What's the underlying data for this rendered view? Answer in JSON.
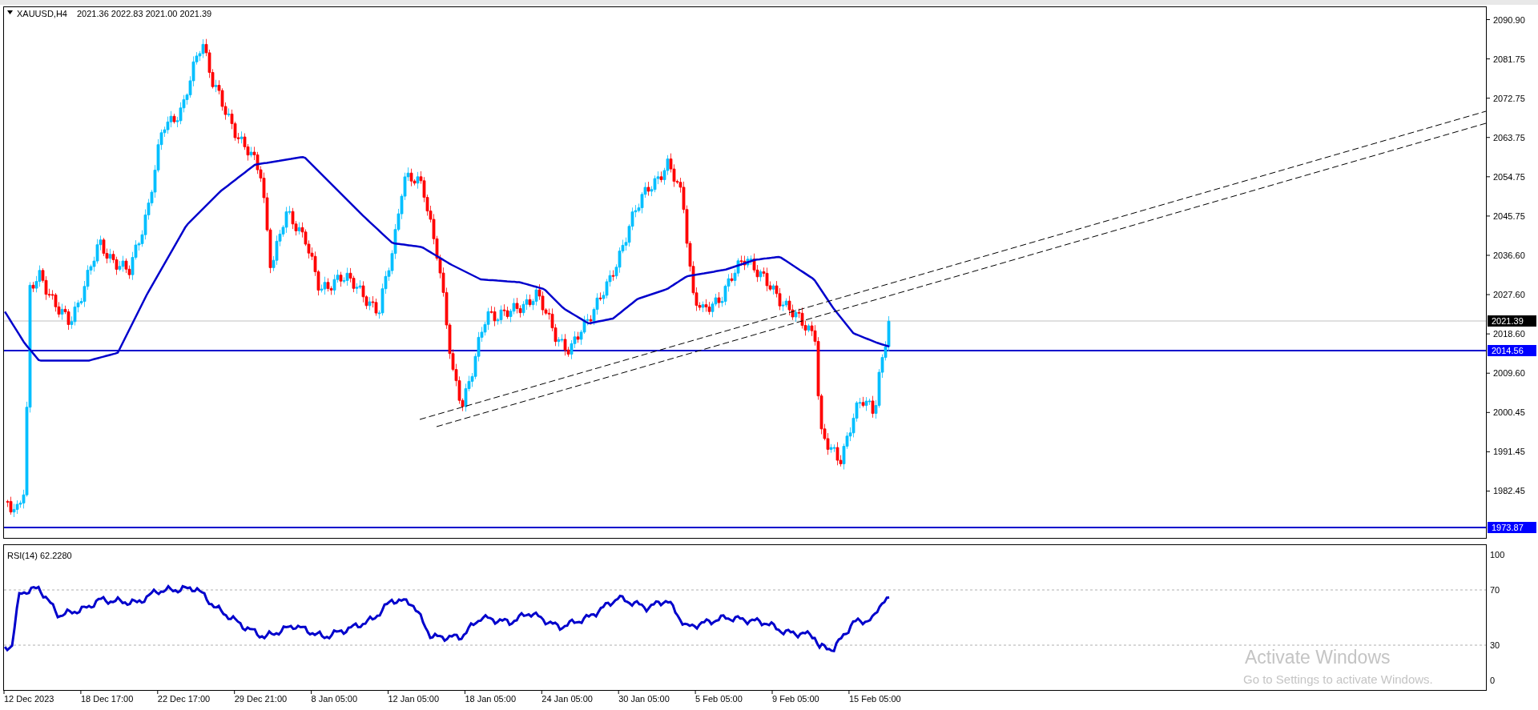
{
  "chart": {
    "title": "XAUUSD,H4",
    "ohlc": "2021.36 2022.83 2021.00 2021.39"
  },
  "price_axis": {
    "labels": [
      "2090.90",
      "2081.75",
      "2072.75",
      "2063.75",
      "2054.75",
      "2045.75",
      "2036.60",
      "2027.60",
      "2018.60",
      "2009.60",
      "2000.45",
      "1991.45",
      "1982.45"
    ]
  },
  "price_tags": [
    {
      "kind": "bid",
      "label": "2021.39"
    },
    {
      "kind": "level",
      "label": "2014.56"
    },
    {
      "kind": "level",
      "label": "1973.87"
    }
  ],
  "indicator": {
    "label": "RSI(14) 62.2280",
    "axis_labels": [
      "100",
      "70",
      "30",
      "0"
    ]
  },
  "time_axis": {
    "labels": [
      "12 Dec 2023",
      "18 Dec 17:00",
      "22 Dec 17:00",
      "29 Dec 21:00",
      "8 Jan 05:00",
      "12 Jan 05:00",
      "18 Jan 05:00",
      "24 Jan 05:00",
      "30 Jan 05:00",
      "5 Feb 05:00",
      "9 Feb 05:00",
      "15 Feb 05:00"
    ]
  },
  "watermark": {
    "title": "Activate Windows",
    "hint": "Go to Settings to activate Windows."
  }
}
